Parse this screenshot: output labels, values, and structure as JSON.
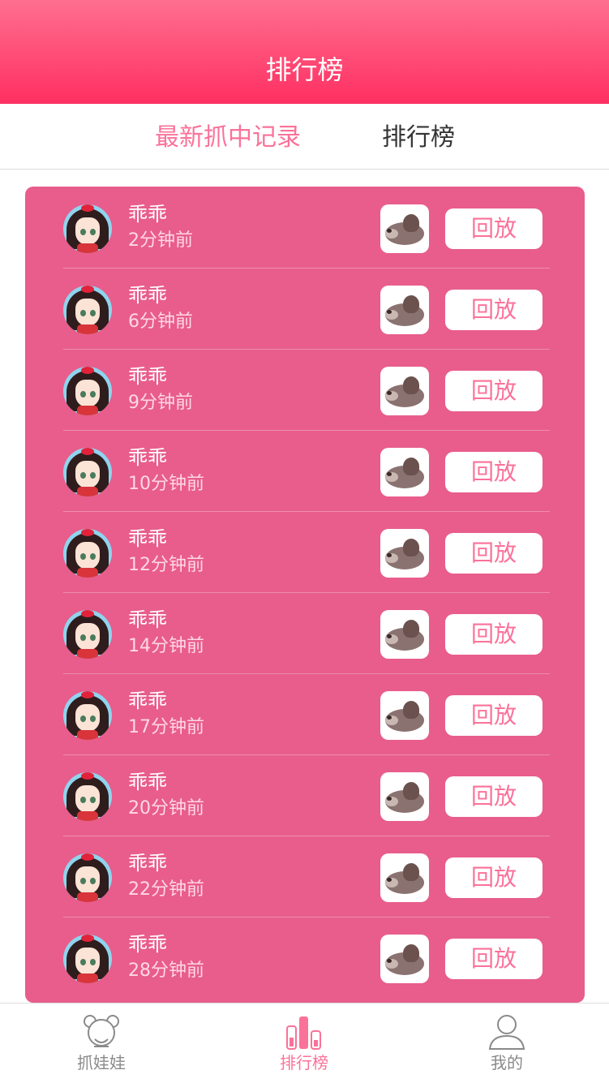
{
  "header": {
    "title": "排行榜"
  },
  "tabs": [
    {
      "label": "最新抓中记录",
      "active": true
    },
    {
      "label": "排行榜",
      "active": false
    }
  ],
  "colors": {
    "primary": "#fb7299",
    "panel": "#e85d8b",
    "divider": "#ef8dae",
    "time_text": "#ffd7e7",
    "tab_inactive": "#353535"
  },
  "records": [
    {
      "name": "乖乖",
      "time": "2分钟前",
      "button": "回放"
    },
    {
      "name": "乖乖",
      "time": "6分钟前",
      "button": "回放"
    },
    {
      "name": "乖乖",
      "time": "9分钟前",
      "button": "回放"
    },
    {
      "name": "乖乖",
      "time": "10分钟前",
      "button": "回放"
    },
    {
      "name": "乖乖",
      "time": "12分钟前",
      "button": "回放"
    },
    {
      "name": "乖乖",
      "time": "14分钟前",
      "button": "回放"
    },
    {
      "name": "乖乖",
      "time": "17分钟前",
      "button": "回放"
    },
    {
      "name": "乖乖",
      "time": "20分钟前",
      "button": "回放"
    },
    {
      "name": "乖乖",
      "time": "22分钟前",
      "button": "回放"
    },
    {
      "name": "乖乖",
      "time": "28分钟前",
      "button": "回放"
    }
  ],
  "bottom_nav": [
    {
      "label": "抓娃娃",
      "icon": "claw-doll-icon",
      "active": false
    },
    {
      "label": "排行榜",
      "icon": "ranking-bars-icon",
      "active": true
    },
    {
      "label": "我的",
      "icon": "user-profile-icon",
      "active": false
    }
  ]
}
